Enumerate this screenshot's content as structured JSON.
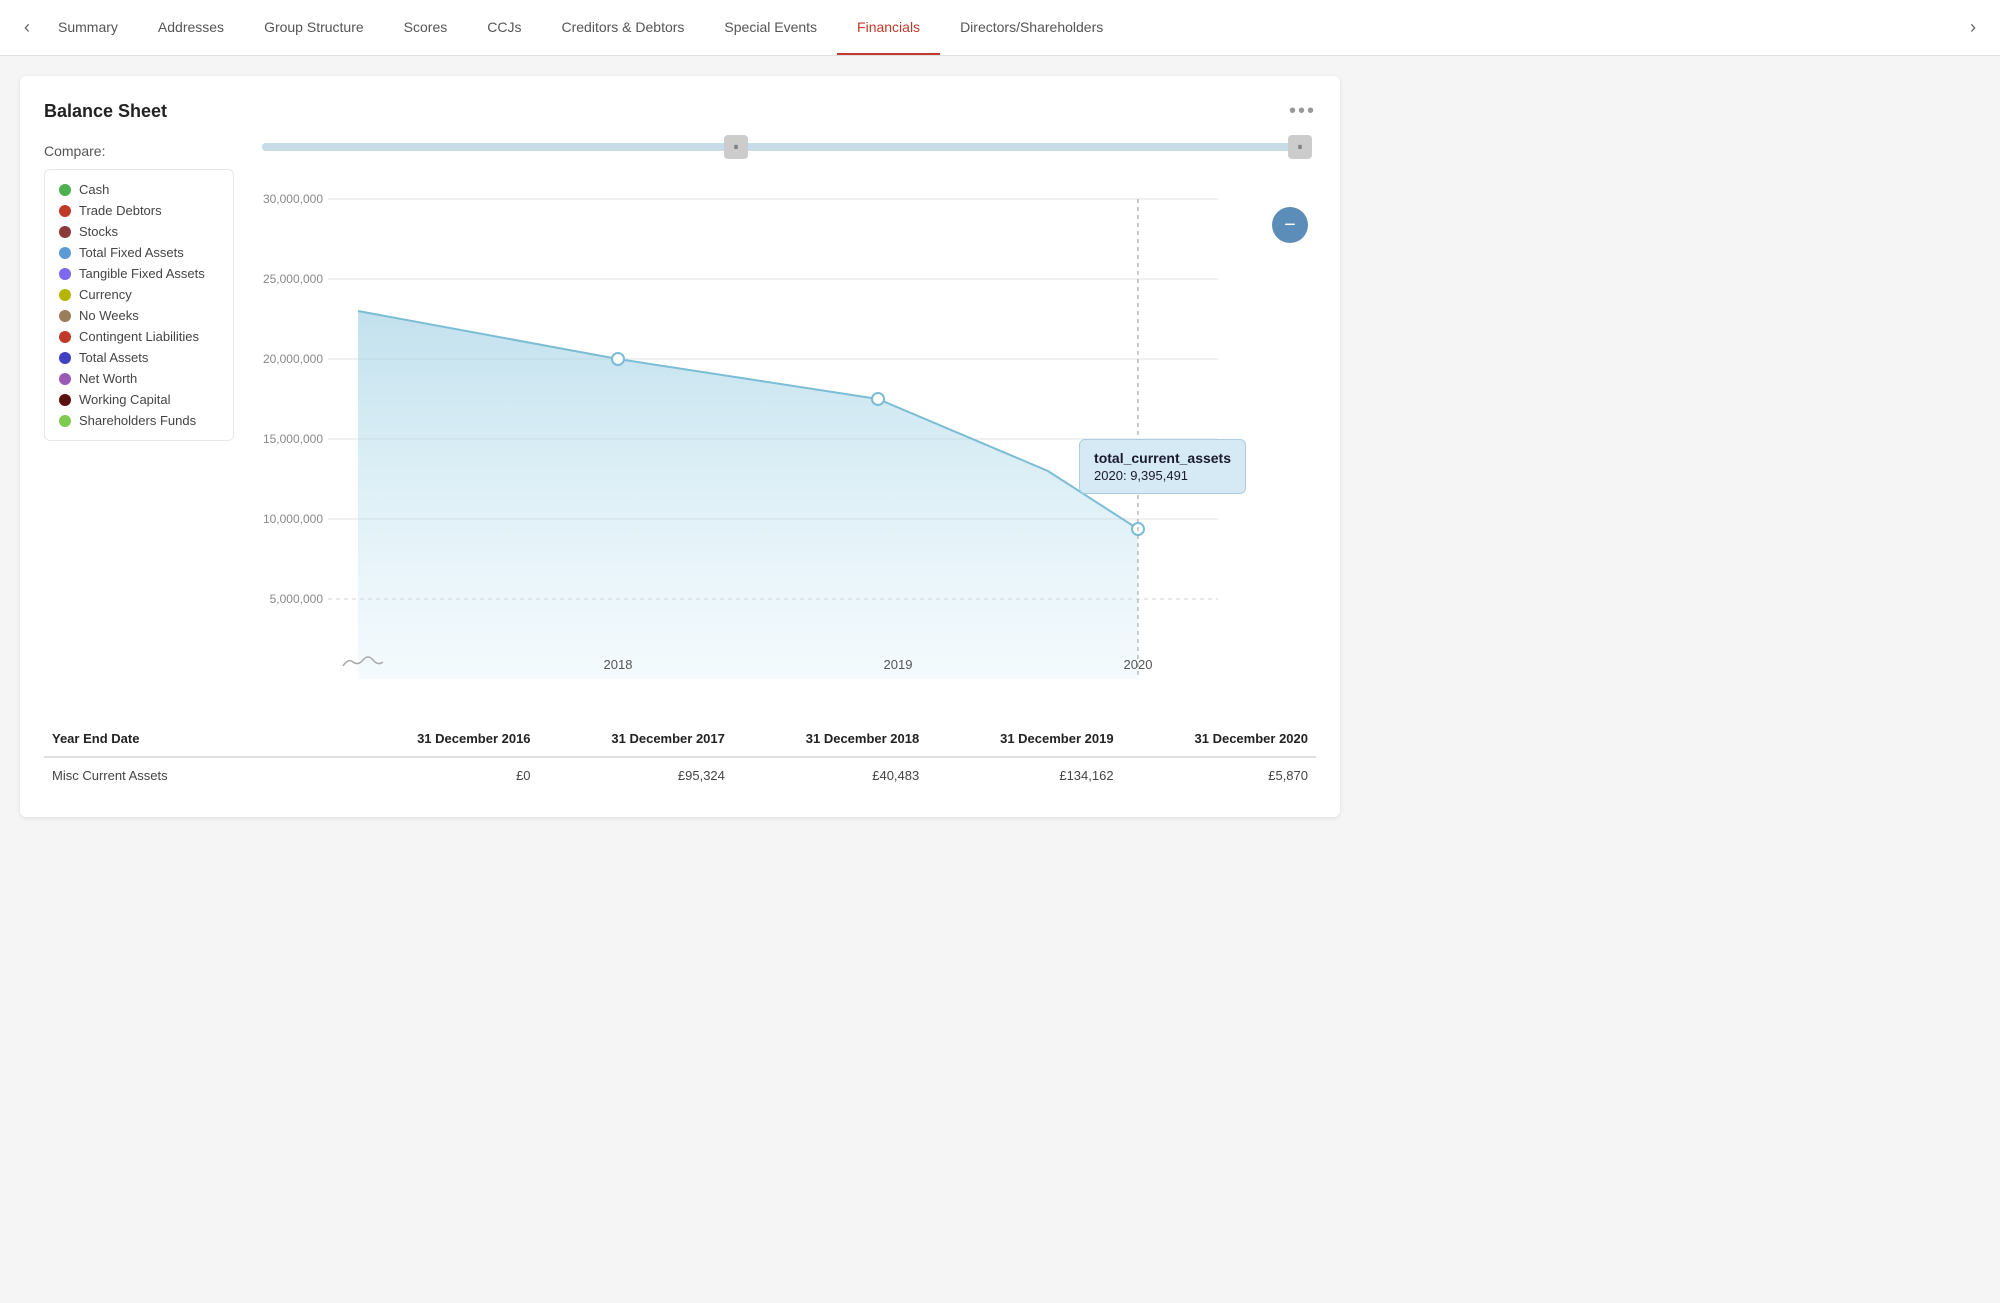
{
  "nav": {
    "prev_arrow": "‹",
    "next_arrow": "›",
    "tabs": [
      {
        "id": "summary",
        "label": "Summary",
        "active": false
      },
      {
        "id": "addresses",
        "label": "Addresses",
        "active": false
      },
      {
        "id": "group-structure",
        "label": "Group Structure",
        "active": false
      },
      {
        "id": "scores",
        "label": "Scores",
        "active": false
      },
      {
        "id": "ccjs",
        "label": "CCJs",
        "active": false
      },
      {
        "id": "creditors-debtors",
        "label": "Creditors & Debtors",
        "active": false
      },
      {
        "id": "special-events",
        "label": "Special Events",
        "active": false
      },
      {
        "id": "financials",
        "label": "Financials",
        "active": true
      },
      {
        "id": "directors-shareholders",
        "label": "Directors/Shareholders",
        "active": false
      }
    ]
  },
  "card": {
    "title": "Balance Sheet",
    "menu_label": "•••",
    "compare_label": "Compare:"
  },
  "legend": {
    "items": [
      {
        "id": "cash",
        "label": "Cash",
        "color": "#4caf50"
      },
      {
        "id": "trade-debtors",
        "label": "Trade Debtors",
        "color": "#c0392b"
      },
      {
        "id": "stocks",
        "label": "Stocks",
        "color": "#8b3a3a"
      },
      {
        "id": "total-fixed-assets",
        "label": "Total Fixed Assets",
        "color": "#5b9bd5"
      },
      {
        "id": "tangible-fixed-assets",
        "label": "Tangible Fixed Assets",
        "color": "#7b68ee"
      },
      {
        "id": "currency",
        "label": "Currency",
        "color": "#b5b500"
      },
      {
        "id": "no-weeks",
        "label": "No Weeks",
        "color": "#9a7d5a"
      },
      {
        "id": "contingent-liabilities",
        "label": "Contingent Liabilities",
        "color": "#c0392b"
      },
      {
        "id": "total-assets",
        "label": "Total Assets",
        "color": "#4040c0"
      },
      {
        "id": "net-worth",
        "label": "Net Worth",
        "color": "#9b59b6"
      },
      {
        "id": "working-capital",
        "label": "Working Capital",
        "color": "#5c1010"
      },
      {
        "id": "shareholders-funds",
        "label": "Shareholders Funds",
        "color": "#7ecb4f"
      }
    ]
  },
  "chart": {
    "y_labels": [
      "30,000,000",
      "25,000,000",
      "20,000,000",
      "15,000,000",
      "10,000,000",
      "5,000,000"
    ],
    "x_labels": [
      "2018",
      "2019",
      "2020"
    ],
    "tooltip": {
      "title": "total_current_assets",
      "value_label": "2020: 9,395,491"
    },
    "minus_btn_label": "−"
  },
  "table": {
    "headers": [
      "Year End Date",
      "31 December 2016",
      "31 December 2017",
      "31 December 2018",
      "31 December 2019",
      "31 December 2020"
    ],
    "rows": [
      {
        "label": "Misc Current Assets",
        "values": [
          "£0",
          "£95,324",
          "£40,483",
          "£134,162",
          "£5,870"
        ]
      }
    ]
  }
}
